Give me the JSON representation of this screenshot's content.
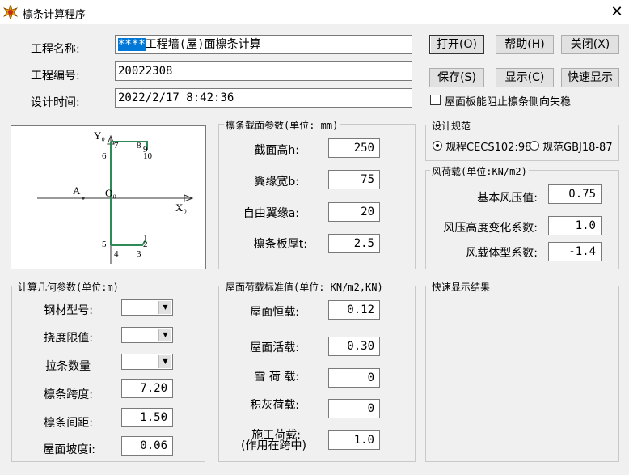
{
  "window": {
    "title": "檩条计算程序",
    "close_glyph": "✕",
    "icon": "star-burst-icon"
  },
  "project": {
    "name_label": "工程名称:",
    "name_highlight": "****",
    "name_value": "工程墙(屋)面檩条计算",
    "number_label": "工程编号:",
    "number_value": "20022308",
    "time_label": "设计时间:",
    "time_value": "2022/2/17 8:42:36"
  },
  "buttons": {
    "open": "打开(O)",
    "help": "帮助(H)",
    "close": "关闭(X)",
    "save": "保存(S)",
    "show": "显示(C)",
    "quick_show": "快速显示"
  },
  "checkbox_label": "屋面板能阻止檩条侧向失稳",
  "diagram": {
    "y_axis": "Y₀",
    "x_axis": "X₀",
    "origin": "O₀",
    "point_a": "A",
    "points": [
      "1",
      "2",
      "3",
      "4",
      "5",
      "6",
      "7",
      "8",
      "9",
      "10"
    ]
  },
  "section": {
    "title": "檩条截面参数(单位: mm)",
    "height_label": "截面高h:",
    "height_value": "250",
    "flange_label": "翼缘宽b:",
    "flange_value": "75",
    "lip_label": "自由翼缘a:",
    "lip_value": "20",
    "thick_label": "檩条板厚t:",
    "thick_value": "2.5"
  },
  "code": {
    "title": "设计规范",
    "option1": "规程CECS102:98",
    "option2": "规范GBJ18-87",
    "selected": "option1"
  },
  "wind": {
    "title": "风荷载(单位:KN/m2)",
    "basic_label": "基本风压值:",
    "basic_value": "0.75",
    "height_label": "风压高度变化系数:",
    "height_value": "1.0",
    "shape_label": "风载体型系数:",
    "shape_value": "-1.4"
  },
  "geometry": {
    "title": "计算几何参数(单位:m)",
    "steel_label": "钢材型号:",
    "steel_value": "",
    "deflection_label": "挠度限值:",
    "deflection_value": "",
    "ties_label": "拉条数量",
    "ties_value": "",
    "span_label": "檩条跨度:",
    "span_value": "7.20",
    "spacing_label": "檩条间距:",
    "spacing_value": "1.50",
    "slope_label": "屋面坡度i:",
    "slope_value": "0.06"
  },
  "loads": {
    "title": "屋面荷载标准值(单位: KN/m2,KN)",
    "dead_label": "屋面恒载:",
    "dead_value": "0.12",
    "live_label": "屋面活载:",
    "live_value": "0.30",
    "snow_label": "雪 荷 载:",
    "snow_value": "0",
    "ash_label": "积灰荷载:",
    "ash_value": "0",
    "construction_label": "施工荷载:",
    "construction_sub": "(作用在跨中)",
    "construction_value": "1.0"
  },
  "quick_result": {
    "title": "快速显示结果"
  }
}
